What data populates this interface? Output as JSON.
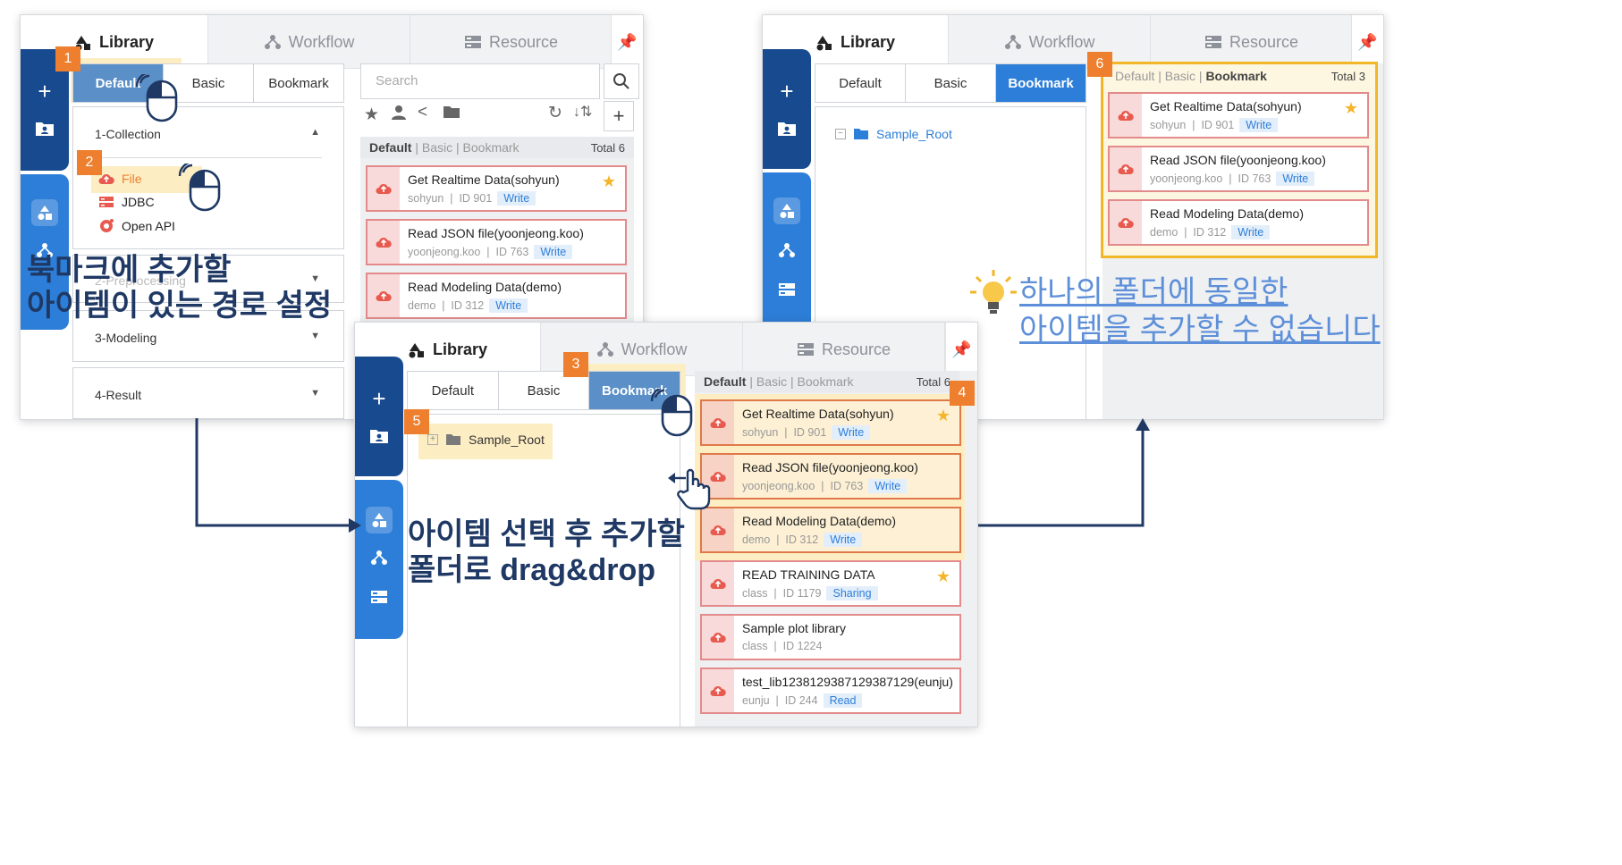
{
  "tabs": {
    "library": "Library",
    "workflow": "Workflow",
    "resource": "Resource"
  },
  "segments": {
    "default": "Default",
    "basic": "Basic",
    "bookmark": "Bookmark"
  },
  "search": {
    "placeholder": "Search"
  },
  "accordion": {
    "collection": "1-Collection",
    "preprocessing": "2-Preprocessing",
    "modeling": "3-Modeling",
    "result": "4-Result",
    "items": [
      "File",
      "JDBC",
      "Open API"
    ]
  },
  "list_header": {
    "default": "Default",
    "basic": "Basic",
    "bookmark": "Bookmark",
    "total_6": "Total  6",
    "total_3": "Total  3",
    "total_cut": "Total  6"
  },
  "cards": [
    {
      "title": "Get Realtime Data(sohyun)",
      "user": "sohyun",
      "id": "ID 901",
      "perm": "Write",
      "star": true
    },
    {
      "title": "Read JSON file(yoonjeong.koo)",
      "user": "yoonjeong.koo",
      "id": "ID 763",
      "perm": "Write",
      "star": false
    },
    {
      "title": "Read Modeling Data(demo)",
      "user": "demo",
      "id": "ID 312",
      "perm": "Write",
      "star": false
    },
    {
      "title": "READ TRAINING DATA",
      "user": "class",
      "id": "ID 1179",
      "perm": "Sharing",
      "star": true
    },
    {
      "title": "Sample plot library",
      "user": "class",
      "id": "ID 1224",
      "perm": "",
      "star": false
    },
    {
      "title": "test_lib1238129387129387129(eunju)",
      "user": "eunju",
      "id": "ID 244",
      "perm": "Read",
      "star": false
    }
  ],
  "tree": {
    "root": "Sample_Root"
  },
  "steps": [
    "1",
    "2",
    "3",
    "4",
    "5",
    "6"
  ],
  "notes": {
    "set_path_line1": "북마크에 추가할",
    "set_path_line2": "아이템이 있는 경로 설정",
    "drag_line1": "아이템 선택 후 추가할",
    "drag_line2": "폴더로 drag&drop",
    "warn_line1": "하나의 폴더에 동일한",
    "warn_line2": "아이템을 추가할 수 없습니다"
  },
  "colors": {
    "sidebar_dark": "#174a8e",
    "sidebar_light": "#2d7ed8",
    "accent": "#2d7ed8",
    "step_tag": "#ee7f2e",
    "highlight": "#fdedc3",
    "card_border": "#e38a8a",
    "star": "#f5b42a",
    "note_text": "#1f3964",
    "warn_text": "#5e8fd9"
  }
}
